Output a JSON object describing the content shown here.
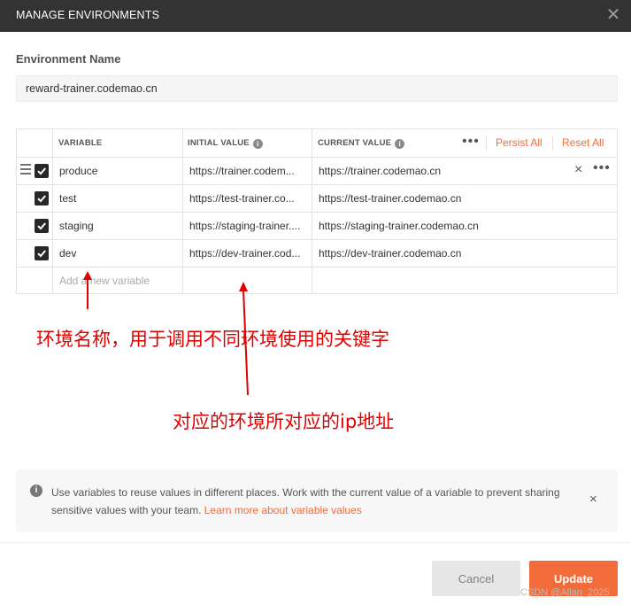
{
  "dialog": {
    "title": "MANAGE ENVIRONMENTS",
    "close_icon": "close-icon"
  },
  "environment": {
    "label": "Environment Name",
    "value": "reward-trainer.codemao.cn"
  },
  "table": {
    "headers": {
      "variable": "VARIABLE",
      "initial_value": "INITIAL VALUE",
      "current_value": "CURRENT VALUE",
      "more": "•••",
      "persist_all": "Persist All",
      "reset_all": "Reset All"
    },
    "rows": [
      {
        "enabled": true,
        "variable": "produce",
        "initial_value": "https://trainer.codem...",
        "current_value": "https://trainer.codemao.cn"
      },
      {
        "enabled": true,
        "variable": "test",
        "initial_value": "https://test-trainer.co...",
        "current_value": "https://test-trainer.codemao.cn"
      },
      {
        "enabled": true,
        "variable": "staging",
        "initial_value": "https://staging-trainer....",
        "current_value": "https://staging-trainer.codemao.cn"
      },
      {
        "enabled": true,
        "variable": "dev",
        "initial_value": "https://dev-trainer.cod...",
        "current_value": "https://dev-trainer.codemao.cn"
      }
    ],
    "add_placeholder": "Add a new variable",
    "row_clear": "×",
    "row_more": "•••"
  },
  "annotations": {
    "variable_note": "环境名称，用于调用不同环境使用的关键字",
    "value_note": "对应的环境所对应的ip地址",
    "color": "#e00000"
  },
  "info": {
    "text": "Use variables to reuse values in different places. Work with the current value of a variable to prevent sharing sensitive values with your team.",
    "link": "Learn more about variable values",
    "dismiss": "×"
  },
  "buttons": {
    "cancel": "Cancel",
    "update": "Update"
  },
  "watermark": "CSDN @Allan_2025",
  "colors": {
    "accent": "#f26b3a",
    "titlebar": "#333333"
  }
}
